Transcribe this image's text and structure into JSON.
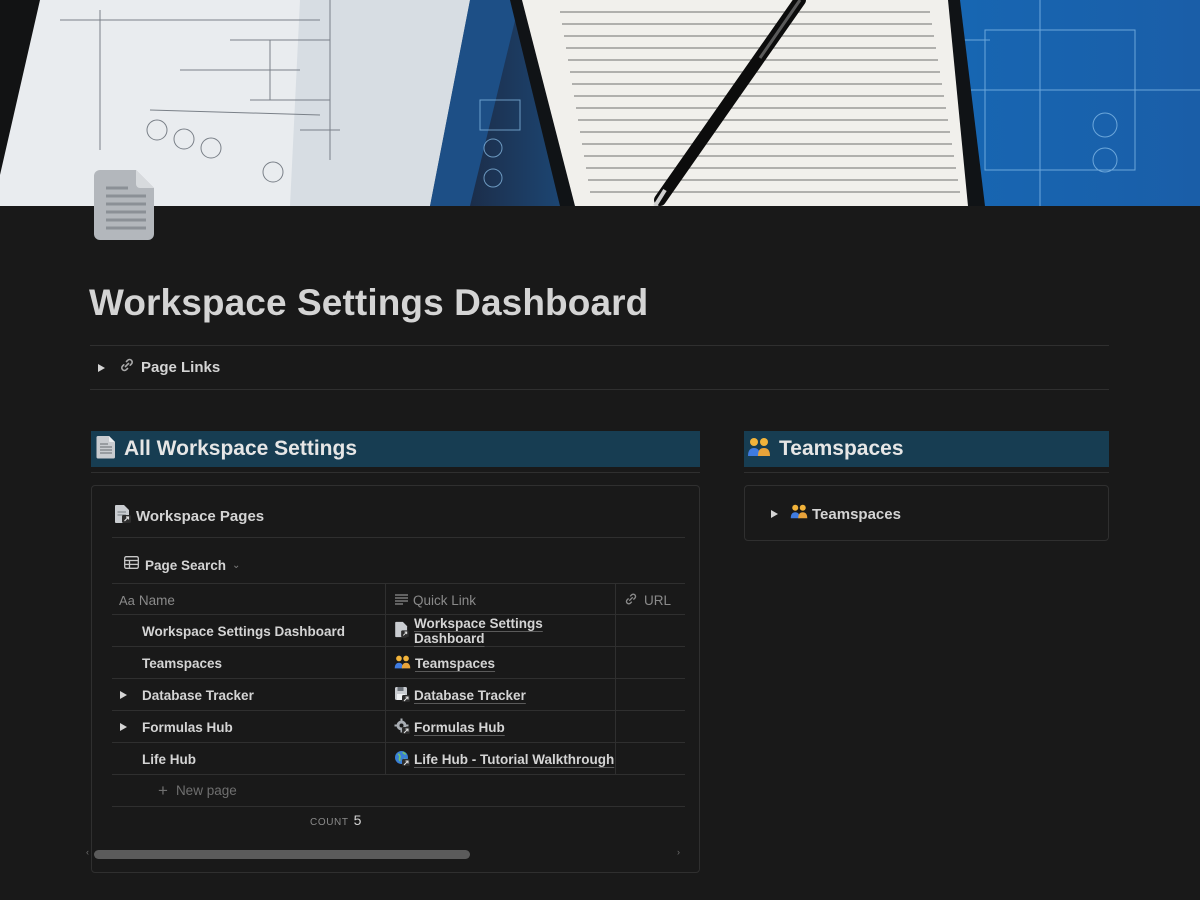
{
  "page": {
    "title": "Workspace Settings Dashboard",
    "icon": "document-icon"
  },
  "page_links": {
    "label": "Page Links",
    "icon": "link-icon"
  },
  "left_heading": {
    "label": "All Workspace Settings",
    "icon": "document-icon"
  },
  "right_heading": {
    "label": "Teamspaces",
    "icon": "teamspaces-icon"
  },
  "database": {
    "title": "Workspace Pages",
    "view": {
      "label": "Page Search",
      "icon": "table-icon"
    },
    "columns": [
      {
        "label": "Name",
        "icon": "text-type-icon",
        "icon_text": "Aa"
      },
      {
        "label": "Quick Link",
        "icon": "lines-icon"
      },
      {
        "label": "URL",
        "icon": "link-icon"
      }
    ],
    "rows": [
      {
        "name": "Workspace Settings Dashboard",
        "expandable": false,
        "link": "Workspace Settings Dashboard",
        "link_icon": "page-link-icon"
      },
      {
        "name": "Teamspaces",
        "expandable": false,
        "link": "Teamspaces",
        "link_icon": "teamspaces-icon"
      },
      {
        "name": "Database Tracker",
        "expandable": true,
        "link": "Database Tracker",
        "link_icon": "floppy-icon"
      },
      {
        "name": "Formulas Hub",
        "expandable": true,
        "link": "Formulas Hub",
        "link_icon": "gear-icon"
      },
      {
        "name": "Life Hub",
        "expandable": false,
        "link": "Life Hub - Tutorial Walkthrough",
        "link_icon": "globe-icon"
      }
    ],
    "new_page": "New page",
    "count_label": "COUNT",
    "count_value": "5"
  },
  "teamspaces_toggle": {
    "label": "Teamspaces",
    "icon": "teamspaces-icon"
  },
  "colors": {
    "background": "#191919",
    "heading_background": "#173d52",
    "text": "#d4d4d4",
    "muted": "#8a8a8a",
    "border": "#2f2f2f"
  }
}
